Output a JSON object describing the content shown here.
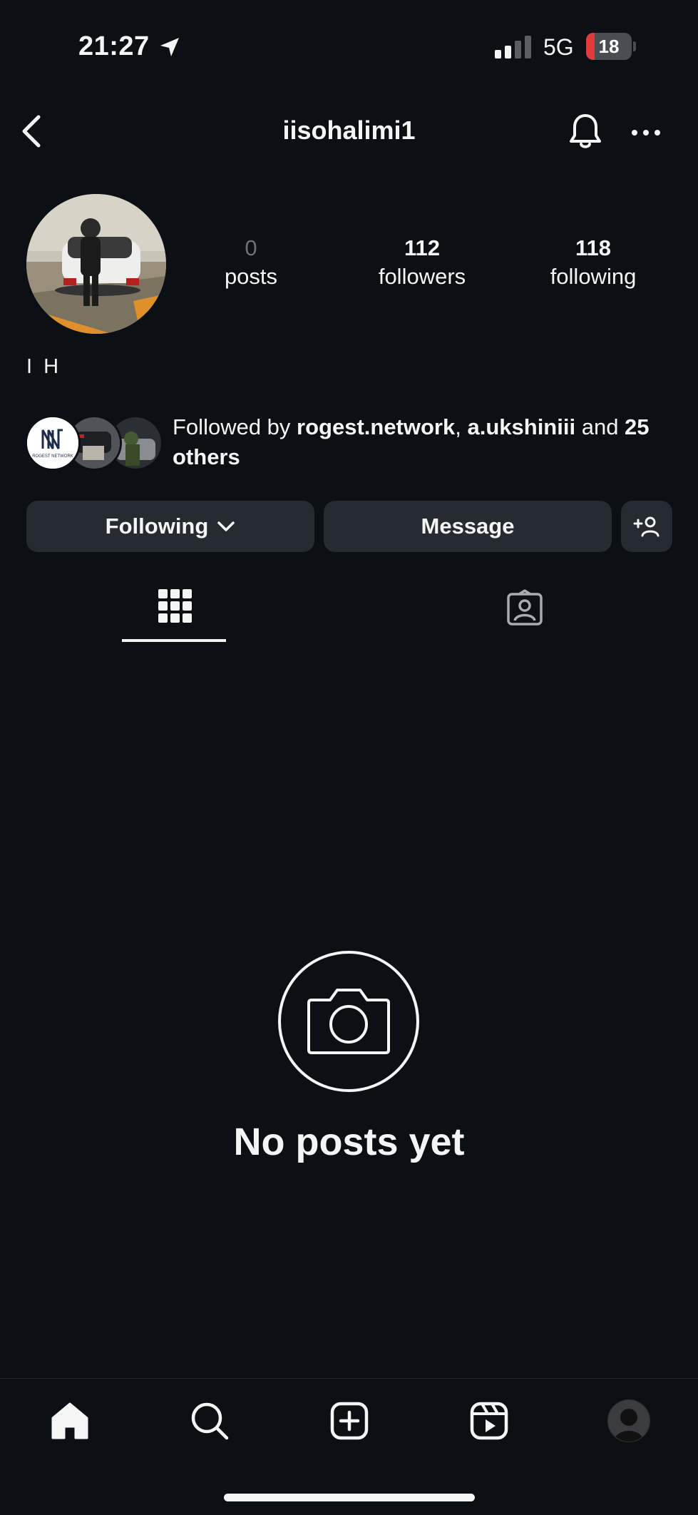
{
  "status_bar": {
    "time": "21:27",
    "network": "5G",
    "battery_level": "18",
    "battery_fraction": 0.18,
    "battery_color": "#e23b3b"
  },
  "header": {
    "username": "iisohalimi1",
    "back_icon": "chevron-left-icon",
    "notifications_icon": "bell-icon",
    "more_icon": "more-horizontal-icon"
  },
  "profile": {
    "stats": {
      "posts_count": "0",
      "posts_label": "posts",
      "followers_count": "112",
      "followers_label": "followers",
      "following_count": "118",
      "following_label": "following"
    },
    "full_name": "I H",
    "followed_by": {
      "prefix": "Followed by ",
      "user1": "rogest.network",
      "sep": ", ",
      "user2": "a.ukshiniii",
      "and": " and ",
      "others": "25 others"
    },
    "mutual_logo_text": "ROGEST NETWORK"
  },
  "actions": {
    "following_label": "Following",
    "message_label": "Message",
    "add_user_icon": "add-person-icon"
  },
  "tabs": {
    "grid_icon": "grid-icon",
    "tagged_icon": "tagged-person-icon"
  },
  "empty_state": {
    "title": "No posts yet",
    "icon": "camera-icon"
  },
  "bottom_nav": {
    "items": [
      "home-icon",
      "search-icon",
      "create-icon",
      "reels-icon",
      "profile-avatar"
    ]
  },
  "colors": {
    "background": "#0c0f14",
    "button": "#262a31",
    "text": "#f5f5f5",
    "muted": "#6d7178"
  }
}
